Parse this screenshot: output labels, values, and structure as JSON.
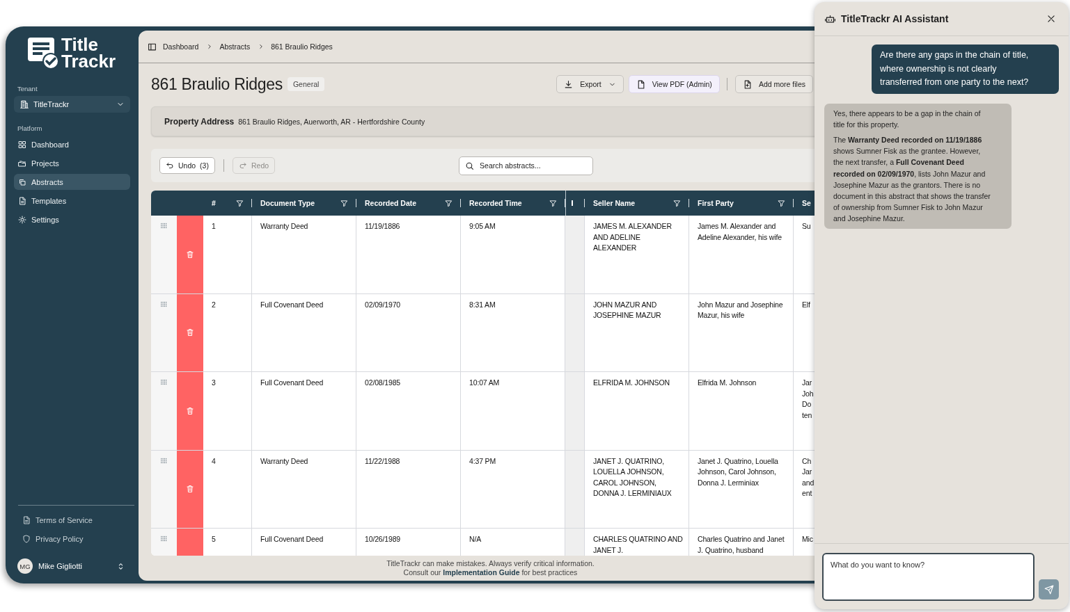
{
  "sidebar": {
    "logo_line_1": "Title",
    "logo_line_2": "Trackr",
    "tenant_label": "Tenant",
    "tenant": "TitleTrackr",
    "section_label": "Platform",
    "nav": [
      {
        "label": "Dashboard",
        "selected": false
      },
      {
        "label": "Projects",
        "selected": false
      },
      {
        "label": "Abstracts",
        "selected": true
      },
      {
        "label": "Templates",
        "selected": false
      },
      {
        "label": "Settings",
        "selected": false
      }
    ],
    "footer_links": [
      "Terms of Service",
      "Privacy Policy"
    ],
    "user": {
      "initials": "MG",
      "name": "Mike Gigliotti"
    }
  },
  "breadcrumbs": [
    "Dashboard",
    "Abstracts",
    "861 Braulio Ridges"
  ],
  "page": {
    "title": "861 Braulio Ridges",
    "badge": "General"
  },
  "actions": [
    {
      "label": "Export",
      "dropdown": true,
      "highlighted": false
    },
    {
      "label": "View PDF (Admin)",
      "dropdown": false,
      "highlighted": true
    },
    {
      "label": "Add more files",
      "dropdown": false,
      "highlighted": false
    }
  ],
  "property": {
    "label": "Property Address",
    "value": "861 Braulio Ridges, Auerworth, AR - Hertfordshire County"
  },
  "toolbar": {
    "undo": {
      "label": "Undo",
      "count": "(3)",
      "disabled": false
    },
    "redo": {
      "label": "Redo",
      "disabled": true
    },
    "search": {
      "placeholder": "Search abstracts..."
    }
  },
  "table": {
    "columns": [
      {
        "label": "#",
        "filter": true
      },
      {
        "label": "Document Type",
        "filter": true
      },
      {
        "label": "Recorded Date",
        "filter": true
      },
      {
        "label": "Recorded Time",
        "filter": true
      },
      {
        "label": "Seller Name",
        "filter": true
      },
      {
        "label": "First Party",
        "filter": true
      },
      {
        "label": "Se"
      }
    ],
    "rows": [
      {
        "cells": [
          "1",
          "Warranty Deed",
          "11/19/1886",
          "9:05 AM",
          "JAMES M. ALEXANDER AND ADELINE ALEXANDER",
          "James M. Alexander and Adeline Alexander, his wife",
          "Su"
        ]
      },
      {
        "cells": [
          "2",
          "Full Covenant Deed",
          "02/09/1970",
          "8:31 AM",
          "JOHN MAZUR AND JOSEPHINE MAZUR",
          "John Mazur and Josephine Mazur, his wife",
          "Elf"
        ]
      },
      {
        "cells": [
          "3",
          "Full Covenant Deed",
          "02/08/1985",
          "10:07 AM",
          "ELFRIDA M. JOHNSON",
          "Elfrida M. Johnson",
          "Jar Joh Do ten"
        ]
      },
      {
        "cells": [
          "4",
          "Warranty Deed",
          "11/22/1988",
          "4:37 PM",
          "JANET J. QUATRINO, LOUELLA JOHNSON, CAROL JOHNSON, DONNA J. LERMINIAUX",
          "Janet J. Quatrino, Louella Johnson, Carol Johnson, Donna J. Lerminiax",
          "Ch Jar and ent"
        ]
      },
      {
        "cells": [
          "5",
          "Full Covenant Deed",
          "10/26/1989",
          "N/A",
          "CHARLES QUATRINO AND JANET J.",
          "Charles Quatrino and Janet J. Quatrino, husband",
          "Mic"
        ]
      }
    ]
  },
  "disclaimer": [
    "TitleTrackr can make mistakes. Always verify critical information.",
    "Consult our **Implementation Guide** for best practices"
  ],
  "assistant": {
    "title": "TitleTrackr AI Assistant",
    "messages": [
      {
        "kind": "question",
        "paragraphs": [
          "Are there any gaps in the chain of title, where ownership is not clearly transferred from one party to the next?"
        ]
      },
      {
        "kind": "answer",
        "paragraphs": [
          "Yes, there appears to be a gap in the chain of title for this property.",
          "The **Warranty Deed recorded on 11/19/1886** shows Sumner Fisk as the grantee. However, the next transfer, a **Full Covenant Deed recorded on 02/09/1970**, lists John Mazur and Josephine Mazur as the grantors. There is no document in this abstract that shows the transfer of ownership from Sumner Fisk to John Mazur and Josephine Mazur."
        ]
      }
    ],
    "input": {
      "placeholder": "What do you want to know?"
    }
  }
}
